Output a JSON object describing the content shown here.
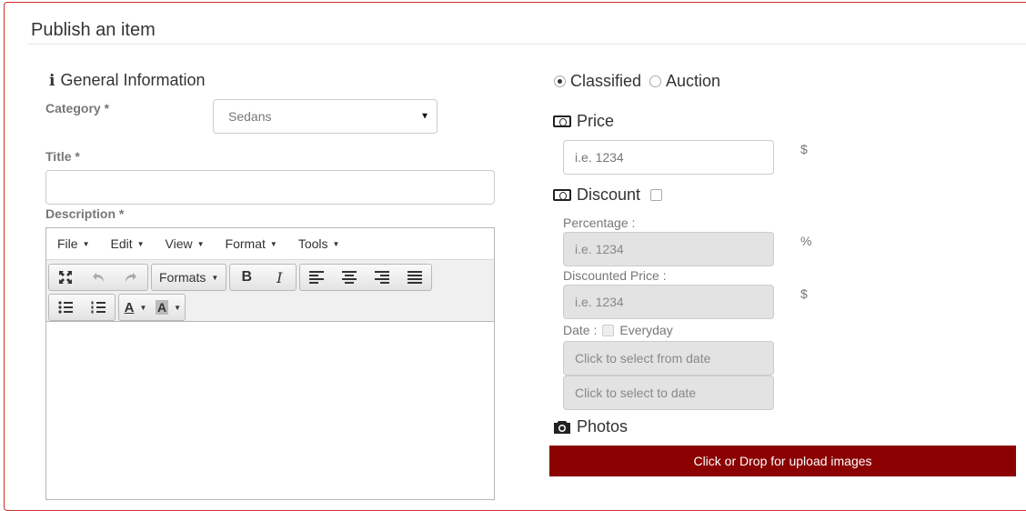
{
  "page": {
    "title": "Publish an item"
  },
  "general": {
    "heading": "General Information",
    "category_label": "Category *",
    "category_value": "Sedans",
    "title_label": "Title *",
    "title_value": "",
    "description_label": "Description *"
  },
  "editor": {
    "menu": [
      "File",
      "Edit",
      "View",
      "Format",
      "Tools"
    ],
    "formats_label": "Formats"
  },
  "listing_type": {
    "options": [
      "Classified",
      "Auction"
    ],
    "selected": "Classified"
  },
  "price": {
    "heading": "Price",
    "placeholder": "i.e. 1234",
    "unit": "$"
  },
  "discount": {
    "heading": "Discount",
    "checked": false,
    "percentage_label": "Percentage :",
    "percentage_placeholder": "i.e. 1234",
    "percentage_unit": "%",
    "discounted_price_label": "Discounted Price :",
    "discounted_price_placeholder": "i.e. 1234",
    "discounted_price_unit": "$",
    "date_label": "Date :",
    "everyday_label": "Everyday",
    "from_date_placeholder": "Click to select from date",
    "to_date_placeholder": "Click to select to date"
  },
  "photos": {
    "heading": "Photos",
    "upload_label": "Click or Drop for upload images"
  },
  "colors": {
    "accent": "#8b0000",
    "panel_border": "#c9302c"
  }
}
